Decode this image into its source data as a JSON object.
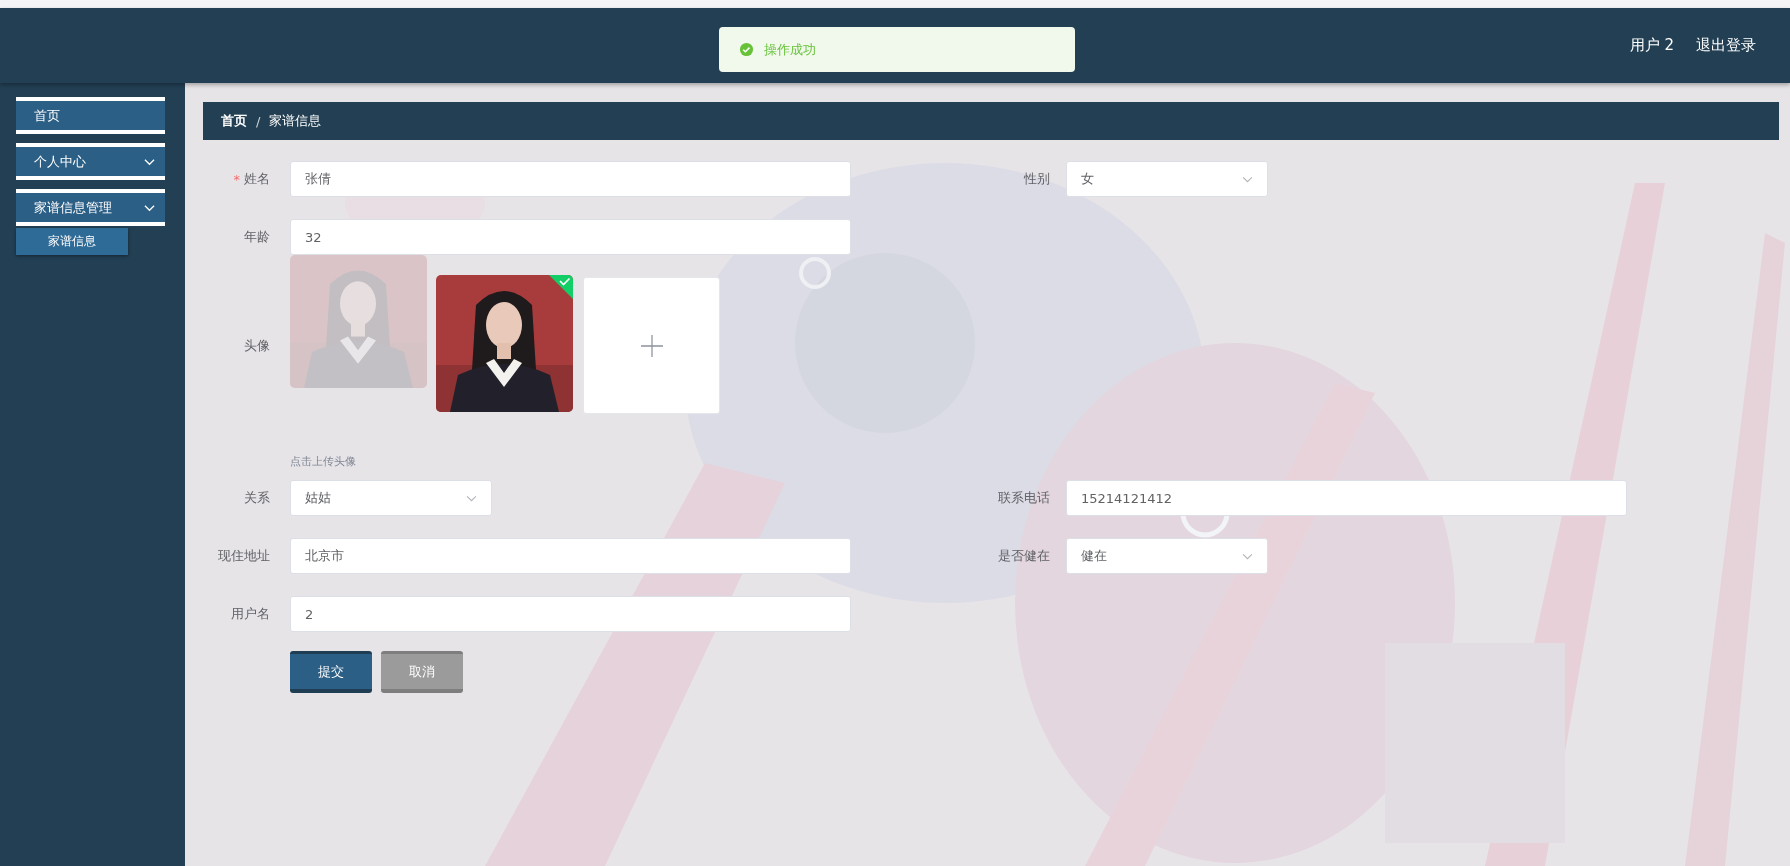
{
  "header": {
    "toast": {
      "kind": "success",
      "text": "操作成功"
    },
    "user": "用户 2",
    "logout": "退出登录"
  },
  "sidebar": {
    "items": [
      {
        "label": "首页",
        "kind": "link"
      },
      {
        "label": "个人中心",
        "kind": "menu"
      },
      {
        "label": "家谱信息管理",
        "kind": "menu",
        "children": [
          {
            "label": "家谱信息",
            "selected": true
          }
        ]
      }
    ]
  },
  "breadcrumb": {
    "items": [
      "首页",
      "家谱信息"
    ],
    "separator": "/"
  },
  "form": {
    "required_mark": "*",
    "rows": [
      {
        "left": {
          "label": "姓名",
          "kind": "input",
          "value": "张倩",
          "required": true
        },
        "right": {
          "label": "性别",
          "kind": "select",
          "value": "女"
        }
      },
      {
        "left": {
          "label": "年龄",
          "kind": "input",
          "value": "32"
        }
      },
      {
        "left": {
          "label": "头像",
          "kind": "upload",
          "images": [
            {
              "kind": "picture",
              "ghost": true,
              "uploaded": false
            },
            {
              "kind": "picture",
              "ghost": false,
              "uploaded": true
            }
          ],
          "hint": "点击上传头像"
        }
      },
      {
        "left": {
          "label": "关系",
          "kind": "select",
          "value": "姑姑"
        },
        "right": {
          "label": "联系电话",
          "kind": "input",
          "value": "15214121412"
        }
      },
      {
        "left": {
          "label": "现住地址",
          "kind": "input",
          "value": "北京市"
        },
        "right": {
          "label": "是否健在",
          "kind": "select",
          "value": "健在"
        }
      },
      {
        "left": {
          "label": "用户名",
          "kind": "input",
          "value": "2"
        }
      }
    ],
    "buttons": [
      {
        "label": "提交",
        "kind": "primary"
      },
      {
        "label": "取消",
        "kind": "secondary"
      }
    ]
  }
}
